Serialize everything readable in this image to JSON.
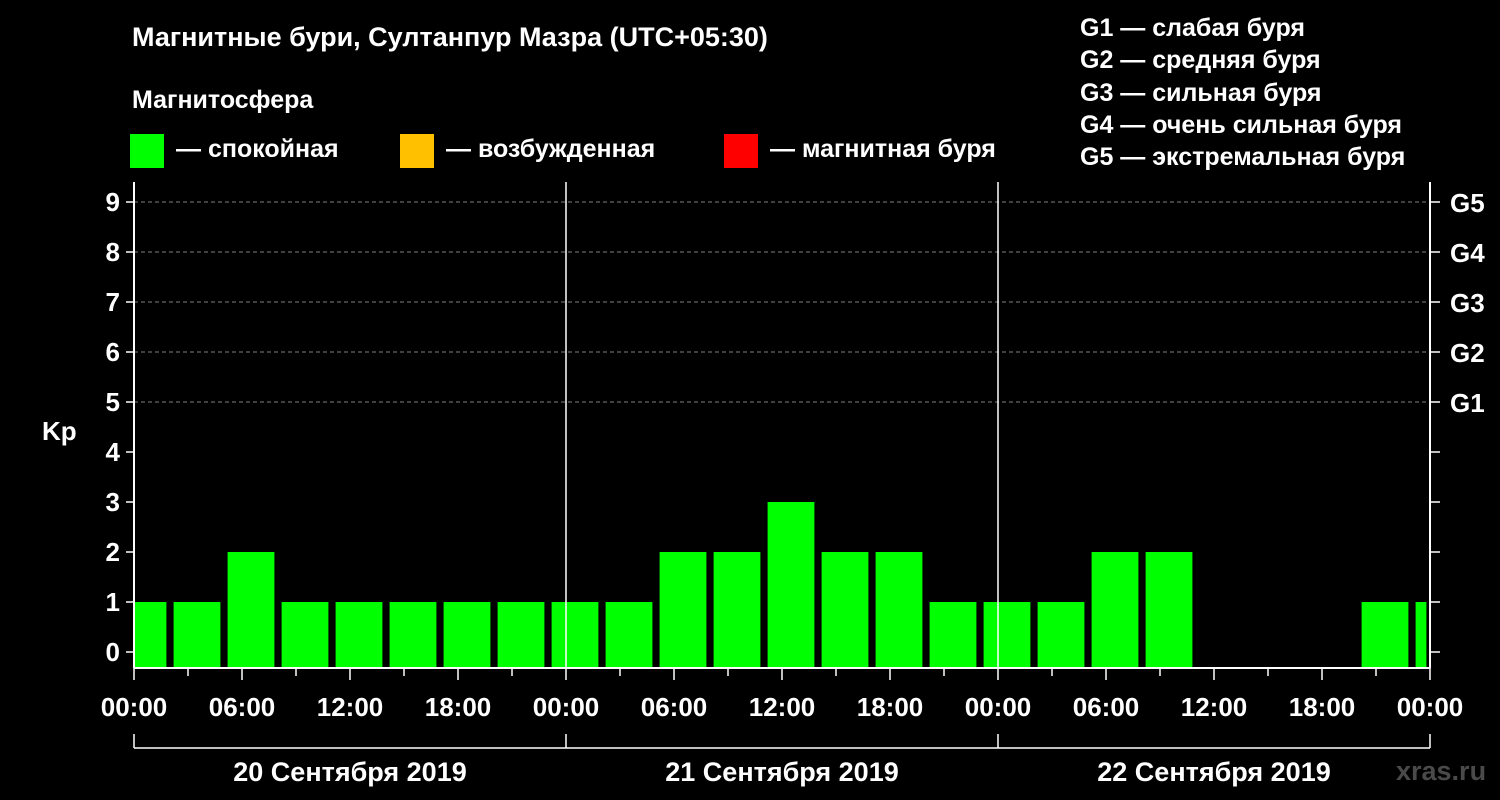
{
  "header": {
    "title": "Магнитные бури, Султанпур Мазра (UTC+05:30)",
    "subtitle": "Магнитосфера"
  },
  "legend": [
    {
      "label": "— спокойная",
      "color": "#00ff00"
    },
    {
      "label": "— возбужденная",
      "color": "#ffc000"
    },
    {
      "label": "— магнитная буря",
      "color": "#ff0000"
    }
  ],
  "g_levels": [
    "G1 — слабая буря",
    "G2 — средняя буря",
    "G3 — сильная буря",
    "G4 — очень сильная буря",
    "G5 — экстремальная буря"
  ],
  "watermark": "xras.ru",
  "chart_data": {
    "type": "bar",
    "ylabel": "Kp",
    "ylim": [
      0,
      9
    ],
    "y_ticks": [
      "0",
      "1",
      "2",
      "3",
      "4",
      "5",
      "6",
      "7",
      "8",
      "9"
    ],
    "right_ticks": [
      {
        "kp": 5,
        "label": "G1"
      },
      {
        "kp": 6,
        "label": "G2"
      },
      {
        "kp": 7,
        "label": "G3"
      },
      {
        "kp": 8,
        "label": "G4"
      },
      {
        "kp": 9,
        "label": "G5"
      }
    ],
    "x_tick_labels": [
      "00:00",
      "06:00",
      "12:00",
      "18:00",
      "00:00",
      "06:00",
      "12:00",
      "18:00",
      "00:00",
      "06:00",
      "12:00",
      "18:00",
      "00:00"
    ],
    "day_labels": [
      "20 Сентября 2019",
      "21 Сентября 2019",
      "22 Сентября 2019"
    ],
    "grid_dashed_at": [
      5,
      6,
      7,
      8,
      9
    ],
    "bar_color": "#00ff00",
    "bars": [
      {
        "start_hour": 0.0,
        "end_hour": 1.8,
        "kp": 1
      },
      {
        "start_hour": 2.2,
        "end_hour": 4.8,
        "kp": 1
      },
      {
        "start_hour": 5.2,
        "end_hour": 7.8,
        "kp": 2
      },
      {
        "start_hour": 8.2,
        "end_hour": 10.8,
        "kp": 1
      },
      {
        "start_hour": 11.2,
        "end_hour": 13.8,
        "kp": 1
      },
      {
        "start_hour": 14.2,
        "end_hour": 16.8,
        "kp": 1
      },
      {
        "start_hour": 17.2,
        "end_hour": 19.8,
        "kp": 1
      },
      {
        "start_hour": 20.2,
        "end_hour": 22.8,
        "kp": 1
      },
      {
        "start_hour": 23.2,
        "end_hour": 25.8,
        "kp": 1
      },
      {
        "start_hour": 26.2,
        "end_hour": 28.8,
        "kp": 1
      },
      {
        "start_hour": 29.2,
        "end_hour": 31.8,
        "kp": 2
      },
      {
        "start_hour": 32.2,
        "end_hour": 34.8,
        "kp": 2
      },
      {
        "start_hour": 35.2,
        "end_hour": 37.8,
        "kp": 3
      },
      {
        "start_hour": 38.2,
        "end_hour": 40.8,
        "kp": 2
      },
      {
        "start_hour": 41.2,
        "end_hour": 43.8,
        "kp": 2
      },
      {
        "start_hour": 44.2,
        "end_hour": 46.8,
        "kp": 1
      },
      {
        "start_hour": 47.2,
        "end_hour": 49.8,
        "kp": 1
      },
      {
        "start_hour": 50.2,
        "end_hour": 52.8,
        "kp": 1
      },
      {
        "start_hour": 53.2,
        "end_hour": 55.8,
        "kp": 2
      },
      {
        "start_hour": 56.2,
        "end_hour": 58.8,
        "kp": 2
      },
      {
        "start_hour": 68.2,
        "end_hour": 70.8,
        "kp": 1
      },
      {
        "start_hour": 71.2,
        "end_hour": 71.8,
        "kp": 1
      }
    ]
  }
}
